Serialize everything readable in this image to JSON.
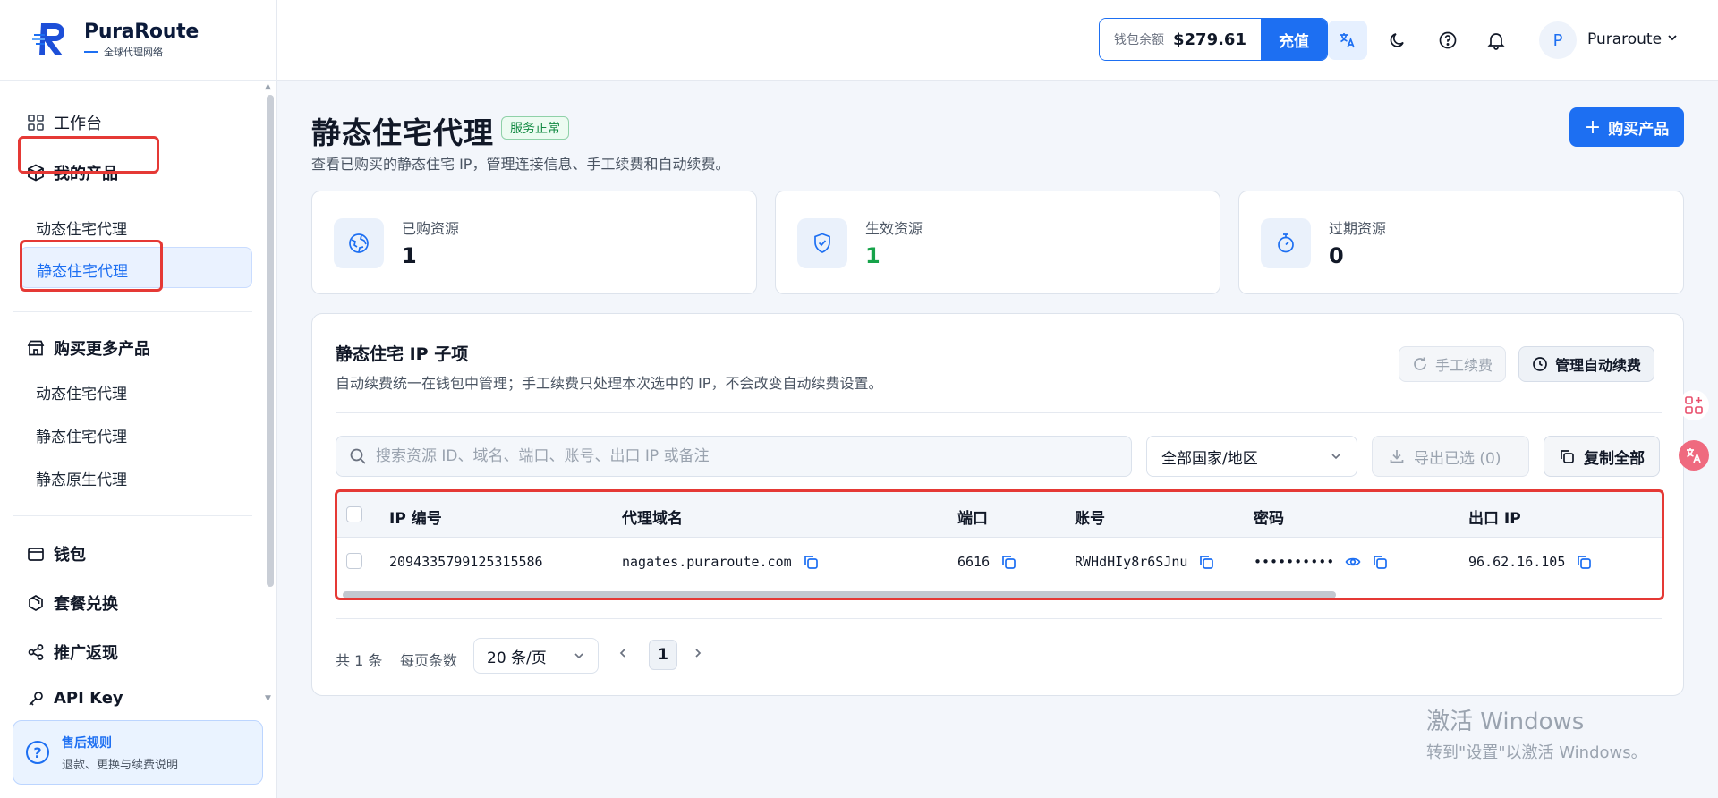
{
  "brand": {
    "name": "PuraRoute",
    "tagline": "全球代理网络"
  },
  "sidebar": {
    "workbench": "工作台",
    "my_products": "我的产品",
    "my_items": [
      "动态住宅代理",
      "静态住宅代理"
    ],
    "buy_more": "购买更多产品",
    "buy_items": [
      "动态住宅代理",
      "静态住宅代理",
      "静态原生代理"
    ],
    "wallet": "钱包",
    "redeem": "套餐兑换",
    "referral": "推广返现",
    "api_key": "API Key",
    "help_title": "售后规则",
    "help_sub": "退款、更换与续费说明"
  },
  "header": {
    "wallet_label": "钱包余额",
    "wallet_amount": "$279.61",
    "recharge": "充值",
    "avatar_initial": "P",
    "username": "Puraroute"
  },
  "page": {
    "title": "静态住宅代理",
    "status": "服务正常",
    "subtitle": "查看已购买的静态住宅 IP，管理连接信息、手工续费和自动续费。",
    "buy_button": "购买产品"
  },
  "stats": [
    {
      "label": "已购资源",
      "value": "1",
      "color": "#111827"
    },
    {
      "label": "生效资源",
      "value": "1",
      "color": "#16a34a"
    },
    {
      "label": "过期资源",
      "value": "0",
      "color": "#111827"
    }
  ],
  "card": {
    "title": "静态住宅 IP 子项",
    "subtitle": "自动续费统一在钱包中管理；手工续费只处理本次选中的 IP，不会改变自动续费设置。",
    "manual_renew": "手工续费",
    "auto_renew": "管理自动续费",
    "search_placeholder": "搜索资源 ID、域名、端口、账号、出口 IP 或备注",
    "region_select": "全部国家/地区",
    "export": "导出已选 (0)",
    "copy_all": "复制全部"
  },
  "table": {
    "columns": [
      "IP 编号",
      "代理域名",
      "端口",
      "账号",
      "密码",
      "出口 IP"
    ],
    "rows": [
      {
        "id": "2094335799125315586",
        "domain": "nagates.puraroute.com",
        "port": "6616",
        "account": "RWHdHIy8r6SJnu",
        "password": "••••••••••",
        "exit_ip": "96.62.16.105"
      }
    ]
  },
  "pager": {
    "total": "共 1 条",
    "per_page_label": "每页条数",
    "per_page": "20 条/页",
    "current": "1"
  },
  "watermark": {
    "line1": "激活 Windows",
    "line2": "转到\"设置\"以激活 Windows。"
  },
  "colors": {
    "accent": "#1d6ff2",
    "highlight": "#e53935",
    "success": "#16a34a"
  }
}
